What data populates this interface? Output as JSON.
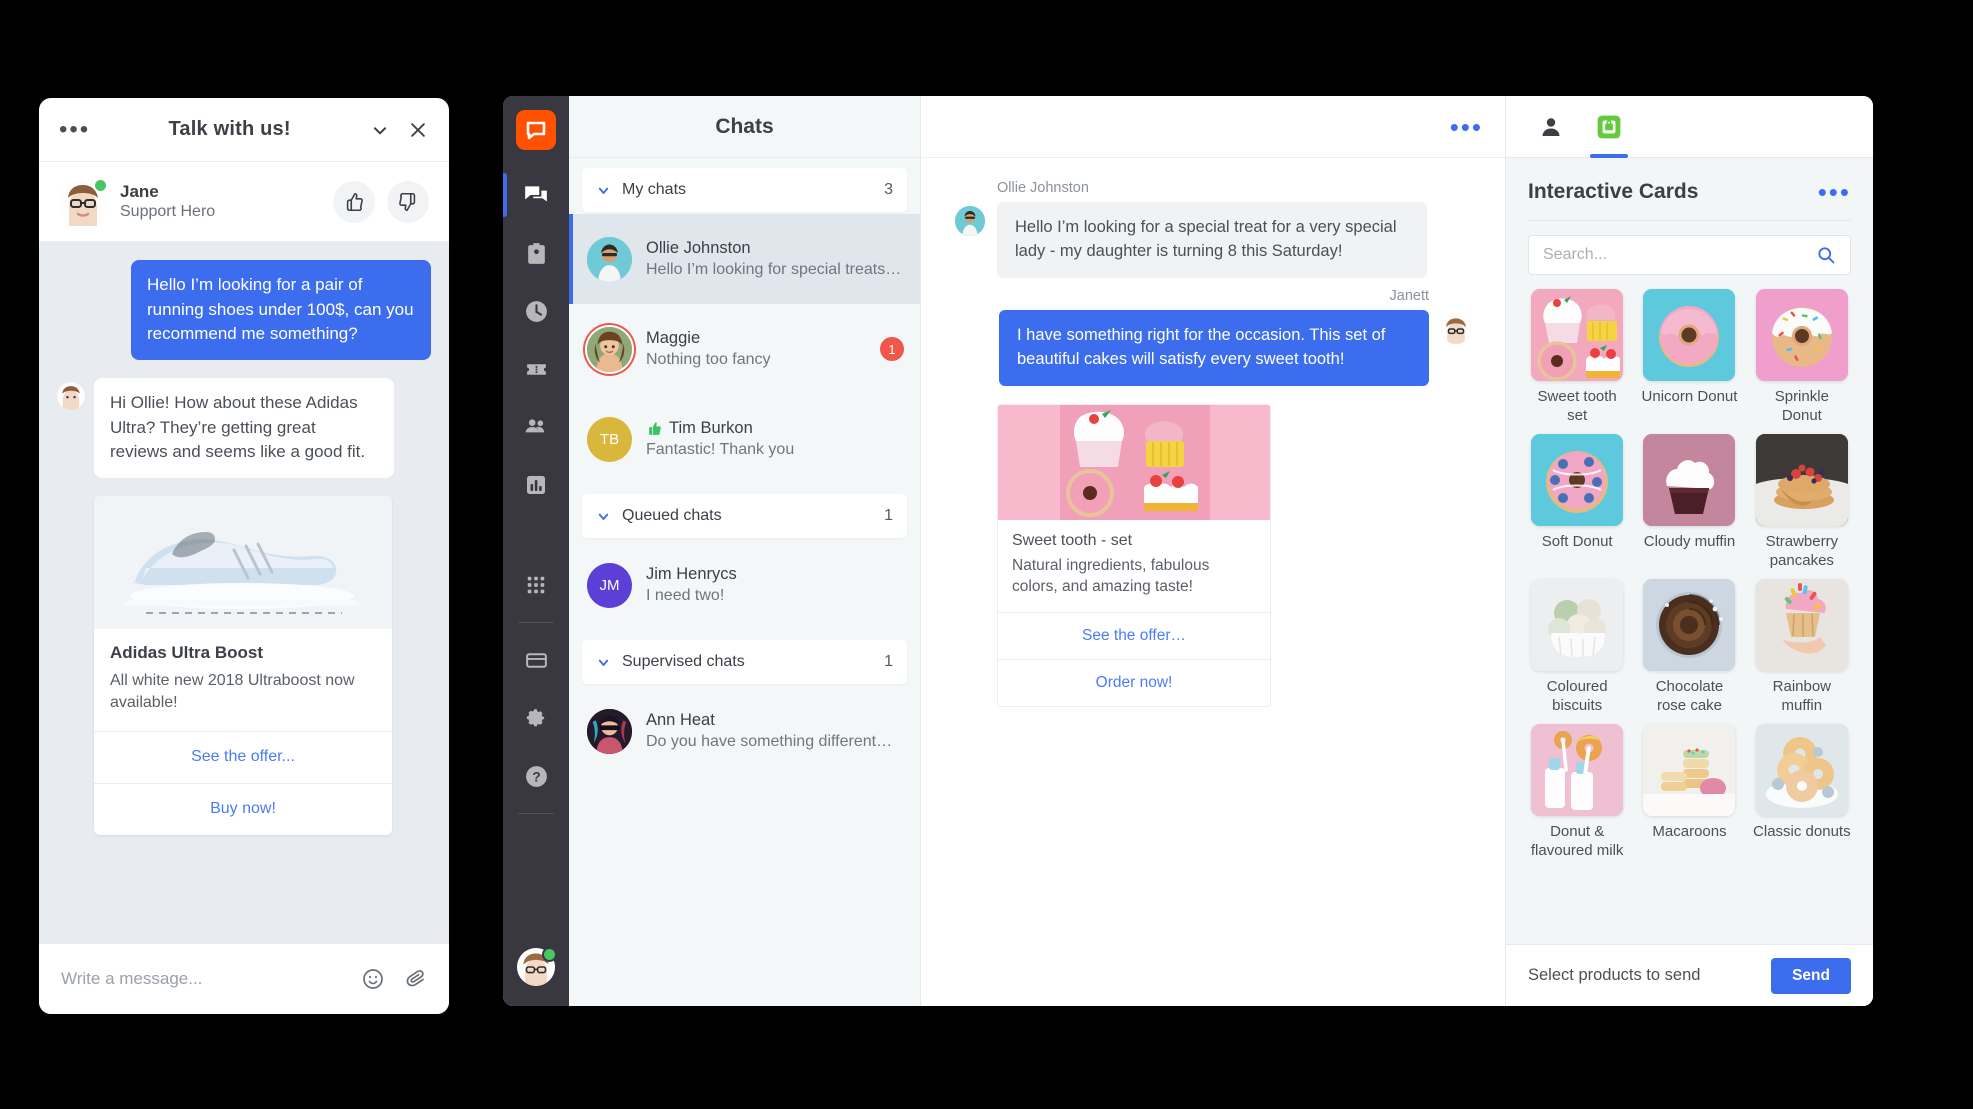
{
  "widget": {
    "menu_icon": "ellipsis-icon",
    "title": "Talk with us!",
    "minimize_icon": "chevron-down-icon",
    "close_icon": "close-icon",
    "agent": {
      "name": "Jane",
      "role": "Support Hero",
      "status": "online"
    },
    "actions": [
      {
        "name": "thumbs-up-button",
        "icon": "thumbs-up-icon"
      },
      {
        "name": "thumbs-down-button",
        "icon": "thumbs-down-icon"
      }
    ],
    "messages": [
      {
        "side": "right",
        "author": "customer",
        "text": "Hello I’m looking for a pair of running shoes under 100$, can you recommend me something?"
      },
      {
        "side": "left",
        "author": "agent",
        "text": "Hi Ollie! How about these Adidas Ultra? They’re getting great reviews and seems like a good fit."
      }
    ],
    "card": {
      "title": "Adidas Ultra Boost",
      "description": "All white new 2018 Ultraboost now available!",
      "actions": [
        "See the offer...",
        "Buy now!"
      ]
    },
    "composer": {
      "placeholder": "Write a message...",
      "emoji_icon": "emoji-icon",
      "attach_icon": "paperclip-icon"
    }
  },
  "app": {
    "rail": {
      "logo": "livechat-logo-icon",
      "items": [
        {
          "name": "chats",
          "icon": "chat-bubbles-icon",
          "active": true
        },
        {
          "name": "archives",
          "icon": "id-badge-icon",
          "active": false
        },
        {
          "name": "history",
          "icon": "clock-icon",
          "active": false
        },
        {
          "name": "tickets",
          "icon": "ticket-icon",
          "active": false
        },
        {
          "name": "team",
          "icon": "people-icon",
          "active": false
        },
        {
          "name": "reports",
          "icon": "bar-chart-icon",
          "active": false
        },
        {
          "name": "apps",
          "icon": "grid-dots-icon",
          "active": false
        },
        {
          "name": "billing",
          "icon": "credit-card-icon",
          "active": false
        },
        {
          "name": "settings",
          "icon": "gear-icon",
          "active": false
        },
        {
          "name": "help",
          "icon": "question-circle-icon",
          "active": false
        }
      ],
      "profile": {
        "name": "profile-avatar",
        "status": "online"
      }
    },
    "chat_list": {
      "header": "Chats",
      "groups": [
        {
          "label": "My chats",
          "count": "3",
          "items": [
            {
              "name": "Ollie Johnston",
              "preview": "Hello I’m looking for special treats …",
              "selected": true,
              "badge": "",
              "avatar_type": "photo",
              "avatar_color": "#6fc9d6",
              "initials": "",
              "rating": ""
            },
            {
              "name": "Maggie",
              "preview": "Nothing too fancy",
              "selected": false,
              "badge": "1",
              "avatar_type": "photo-ring",
              "avatar_color": "#c99a7a",
              "initials": "",
              "rating": ""
            },
            {
              "name": "Tim Burkon",
              "preview": "Fantastic! Thank you",
              "selected": false,
              "badge": "",
              "avatar_type": "initials",
              "avatar_color": "#d9b63c",
              "initials": "TB",
              "rating": "thumbs-up-icon"
            }
          ]
        },
        {
          "label": "Queued chats",
          "count": "1",
          "items": [
            {
              "name": "Jim Henrycs",
              "preview": "I need two!",
              "selected": false,
              "badge": "",
              "avatar_type": "initials",
              "avatar_color": "#5b3fd6",
              "initials": "JM",
              "rating": ""
            }
          ]
        },
        {
          "label": "Supervised chats",
          "count": "1",
          "items": [
            {
              "name": "Ann Heat",
              "preview": "Do you have something different…",
              "selected": false,
              "badge": "",
              "avatar_type": "photo",
              "avatar_color": "#2b1d33",
              "initials": "",
              "rating": ""
            }
          ]
        }
      ]
    },
    "conversation": {
      "menu_icon": "ellipsis-icon",
      "messages": [
        {
          "author": "Ollie Johnston",
          "side": "left",
          "text": "Hello I’m looking for a special treat for a very special lady - my daughter is turning 8 this Saturday!"
        },
        {
          "author": "Janett",
          "side": "right",
          "text": "I have something right for the occasion. This set of beautiful cakes will satisfy every sweet tooth!"
        }
      ],
      "card": {
        "title": "Sweet tooth - set",
        "description": "Natural ingredients, fabulous colors, and amazing taste!",
        "actions": [
          "See the offer…",
          "Order now!"
        ]
      }
    },
    "details": {
      "tabs": [
        {
          "name": "customer-details-tab",
          "icon": "person-icon",
          "active": false
        },
        {
          "name": "interactive-cards-tab",
          "icon": "green-app-icon",
          "active": true
        }
      ],
      "title": "Interactive Cards",
      "menu_icon": "ellipsis-icon",
      "search": {
        "placeholder": "Search...",
        "value": "",
        "icon": "search-icon"
      },
      "products": [
        {
          "label": "Sweet tooth set",
          "bg": "#f0b9c5"
        },
        {
          "label": "Unicorn Donut",
          "bg": "#5ec8dd"
        },
        {
          "label": "Sprinkle Donut",
          "bg": "#f09ecb"
        },
        {
          "label": "Soft Donut",
          "bg": "#5ec8dd"
        },
        {
          "label": "Cloudy muffin",
          "bg": "#c4869c"
        },
        {
          "label": "Strawberry pancakes",
          "bg": "#55514e"
        },
        {
          "label": "Coloured biscuits",
          "bg": "#e9eced"
        },
        {
          "label": "Chocolate rose cake",
          "bg": "#cfd9e2"
        },
        {
          "label": "Rainbow muffin",
          "bg": "#e8e4e0"
        },
        {
          "label": "Donut & flavoured milk",
          "bg": "#eec0d2"
        },
        {
          "label": "Macaroons",
          "bg": "#efedea"
        },
        {
          "label": "Classic donuts",
          "bg": "#dfe6ea"
        }
      ],
      "footer": {
        "hint": "Select products to send",
        "send_label": "Send"
      }
    }
  },
  "colors": {
    "accent_blue": "#3d6def",
    "brand_orange": "#ff5100",
    "badge_red": "#f0564a",
    "online_green": "#48c664",
    "rail_dark": "#393740"
  }
}
